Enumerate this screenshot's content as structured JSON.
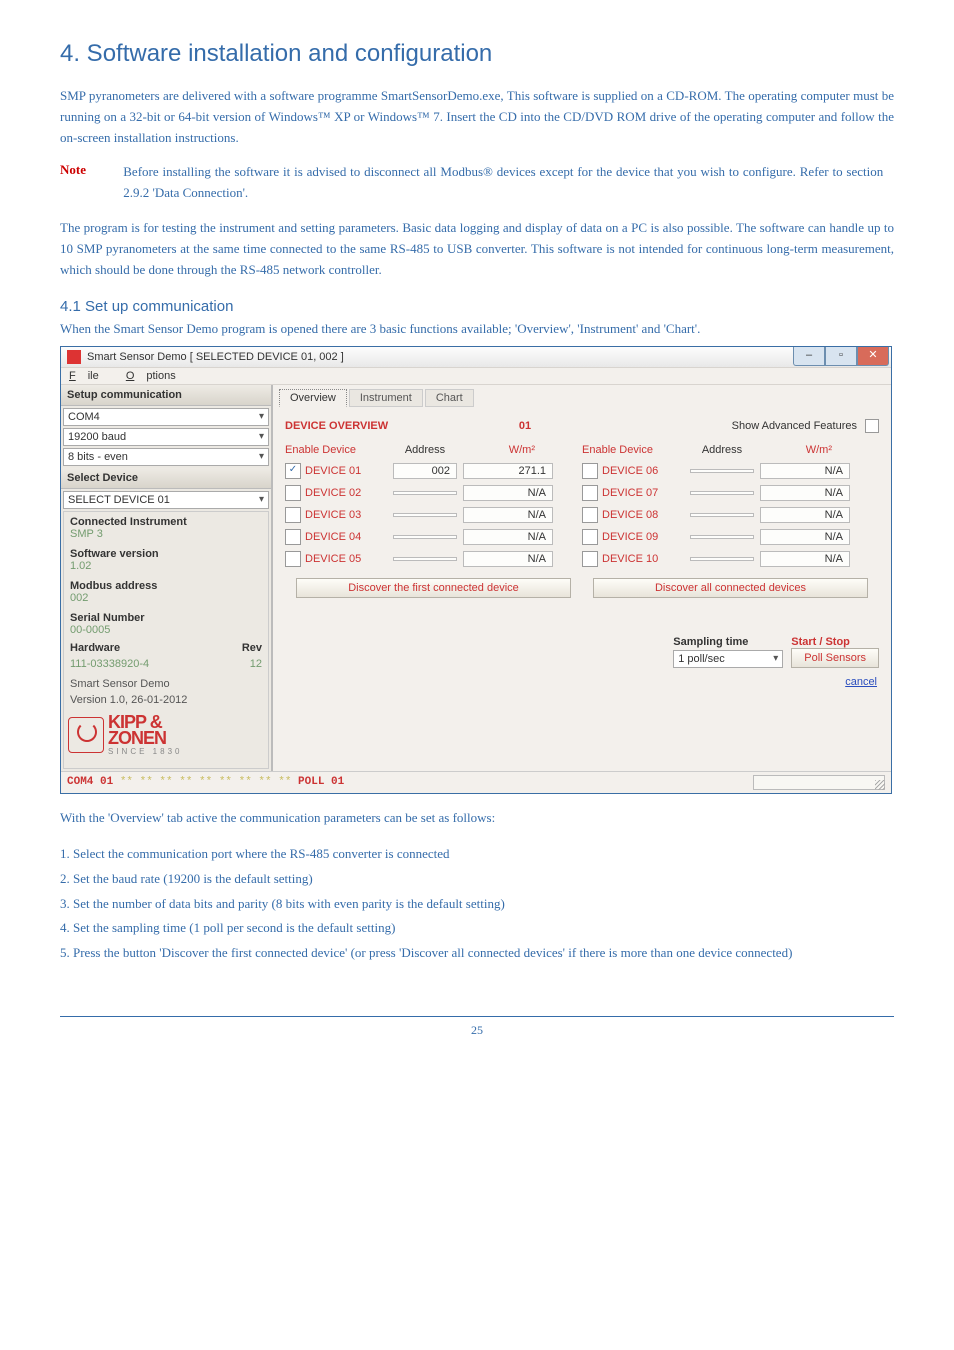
{
  "section_title": "4. Software installation and configuration",
  "para1": "SMP pyranometers are delivered with a software programme SmartSensorDemo.exe, This software is supplied on a CD-ROM. The operating computer must be running on a 32-bit or 64-bit version of Windows™ XP or Windows™ 7. Insert the CD into the CD/DVD ROM drive of the operating computer and follow the on-screen installation instructions.",
  "note_label": "Note",
  "note_text": "Before installing the software it is advised to disconnect all Modbus® devices except for the device that you wish to configure. Refer to section 2.9.2 'Data Connection'.",
  "para2": "The program is for testing the instrument and setting parameters. Basic data logging and display of data on a PC is also possible. The software can handle up to 10 SMP pyranometers at the same time connected to the same RS-485 to USB converter. This software is not intended for continuous long-term measurement, which should be done through the RS-485 network controller.",
  "subsection": "4.1 Set up communication",
  "para3": "When the Smart Sensor Demo program is opened there are 3 basic functions available; 'Overview', 'Instrument' and 'Chart'.",
  "after_img": "With the 'Overview' tab active the communication parameters can be set as follows:",
  "steps": [
    "1. Select the communication port where the RS-485 converter is connected",
    "2. Set the baud rate (19200 is the default setting)",
    "3. Set the number of data bits and parity (8 bits with even parity is the default setting)",
    "4. Set the sampling time (1 poll per second is the default setting)",
    "5. Press the button 'Discover the first connected device' (or press 'Discover all connected devices' if there is more than one device connected)"
  ],
  "page_number": "25",
  "win": {
    "title": "Smart Sensor Demo [ SELECTED DEVICE 01, 002 ]",
    "menu_file": "File",
    "menu_options": "Options",
    "side": {
      "setup_comm": "Setup communication",
      "com": "COM4",
      "baud": "19200 baud",
      "parity": "8 bits - even",
      "select_device_h": "Select Device",
      "select_device_v": "SELECT DEVICE 01",
      "connected_h": "Connected Instrument",
      "connected_v": "SMP 3",
      "swver_h": "Software version",
      "swver_v": "1.02",
      "modbus_h": "Modbus address",
      "modbus_v": "002",
      "serial_h": "Serial Number",
      "serial_v": "00-0005",
      "hw_h": "Hardware",
      "rev_h": "Rev",
      "hw_v": "111-03338920-4",
      "rev_v": "12",
      "demo1": "Smart Sensor Demo",
      "demo2": "Version 1.0, 26-01-2012",
      "logo1": "KIPP &",
      "logo2": "ZONEN",
      "since": "SINCE 1830"
    },
    "main": {
      "tabs": {
        "overview": "Overview",
        "instrument": "Instrument",
        "chart": "Chart"
      },
      "device_overview": "DEVICE OVERVIEW",
      "ov_num": "01",
      "adv": "Show Advanced Features",
      "enable": "Enable Device",
      "address": "Address",
      "wm2": "W/m²",
      "left": [
        {
          "name": "DEVICE 01",
          "addr": "002",
          "val": "271.1",
          "on": true
        },
        {
          "name": "DEVICE 02",
          "addr": "",
          "val": "N/A",
          "on": false
        },
        {
          "name": "DEVICE 03",
          "addr": "",
          "val": "N/A",
          "on": false
        },
        {
          "name": "DEVICE 04",
          "addr": "",
          "val": "N/A",
          "on": false
        },
        {
          "name": "DEVICE 05",
          "addr": "",
          "val": "N/A",
          "on": false
        }
      ],
      "right": [
        {
          "name": "DEVICE 06",
          "addr": "",
          "val": "N/A",
          "on": false
        },
        {
          "name": "DEVICE 07",
          "addr": "",
          "val": "N/A",
          "on": false
        },
        {
          "name": "DEVICE 08",
          "addr": "",
          "val": "N/A",
          "on": false
        },
        {
          "name": "DEVICE 09",
          "addr": "",
          "val": "N/A",
          "on": false
        },
        {
          "name": "DEVICE 10",
          "addr": "",
          "val": "N/A",
          "on": false
        }
      ],
      "disc_first": "Discover the first connected device",
      "disc_all": "Discover all connected devices",
      "sampling": "Sampling time",
      "startstop": "Start / Stop",
      "pollrate": "1 poll/sec",
      "pollbtn": "Poll Sensors",
      "cancel": "cancel",
      "status_prefix": "COM4  01 ",
      "status_stars": "** ** ** ** ** ** ** ** **",
      "status_poll": " POLL 01"
    }
  }
}
